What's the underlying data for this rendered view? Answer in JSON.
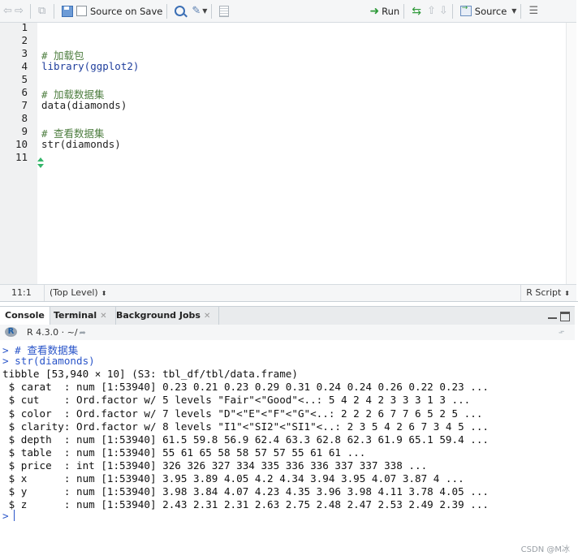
{
  "toolbar": {
    "source_on_save": "Source on Save",
    "run": "Run",
    "source": "Source"
  },
  "editor": {
    "lines": [
      {
        "n": "1",
        "text": ""
      },
      {
        "n": "2",
        "text": ""
      },
      {
        "n": "3",
        "text": "# 加载包"
      },
      {
        "n": "4",
        "text": "library(ggplot2)"
      },
      {
        "n": "5",
        "text": ""
      },
      {
        "n": "6",
        "text": "# 加载数据集"
      },
      {
        "n": "7",
        "text": "data(diamonds)"
      },
      {
        "n": "8",
        "text": ""
      },
      {
        "n": "9",
        "text": "# 查看数据集"
      },
      {
        "n": "10",
        "text": "str(diamonds)"
      },
      {
        "n": "11",
        "text": ""
      }
    ]
  },
  "status": {
    "position": "11:1",
    "scope": "(Top Level)",
    "file_type": "R Script"
  },
  "console_tabs": {
    "console": "Console",
    "terminal": "Terminal",
    "background_jobs": "Background Jobs"
  },
  "console_info": {
    "r_version": "R 4.3.0 · ~/"
  },
  "console": {
    "lines": [
      "> # 查看数据集",
      "> str(diamonds)",
      "tibble [53,940 × 10] (S3: tbl_df/tbl/data.frame)",
      " $ carat  : num [1:53940] 0.23 0.21 0.23 0.29 0.31 0.24 0.24 0.26 0.22 0.23 ...",
      " $ cut    : Ord.factor w/ 5 levels \"Fair\"<\"Good\"<..: 5 4 2 4 2 3 3 3 1 3 ...",
      " $ color  : Ord.factor w/ 7 levels \"D\"<\"E\"<\"F\"<\"G\"<..: 2 2 2 6 7 7 6 5 2 5 ...",
      " $ clarity: Ord.factor w/ 8 levels \"I1\"<\"SI2\"<\"SI1\"<..: 2 3 5 4 2 6 7 3 4 5 ...",
      " $ depth  : num [1:53940] 61.5 59.8 56.9 62.4 63.3 62.8 62.3 61.9 65.1 59.4 ...",
      " $ table  : num [1:53940] 55 61 65 58 58 57 57 55 61 61 ...",
      " $ price  : int [1:53940] 326 326 327 334 335 336 336 337 337 338 ...",
      " $ x      : num [1:53940] 3.95 3.89 4.05 4.2 4.34 3.94 3.95 4.07 3.87 4 ...",
      " $ y      : num [1:53940] 3.98 3.84 4.07 4.23 4.35 3.96 3.98 4.11 3.78 4.05 ...",
      " $ z      : num [1:53940] 2.43 2.31 2.31 2.63 2.75 2.48 2.47 2.53 2.49 2.39 ..."
    ],
    "prompt": ">"
  },
  "watermark": "CSDN @M冰"
}
